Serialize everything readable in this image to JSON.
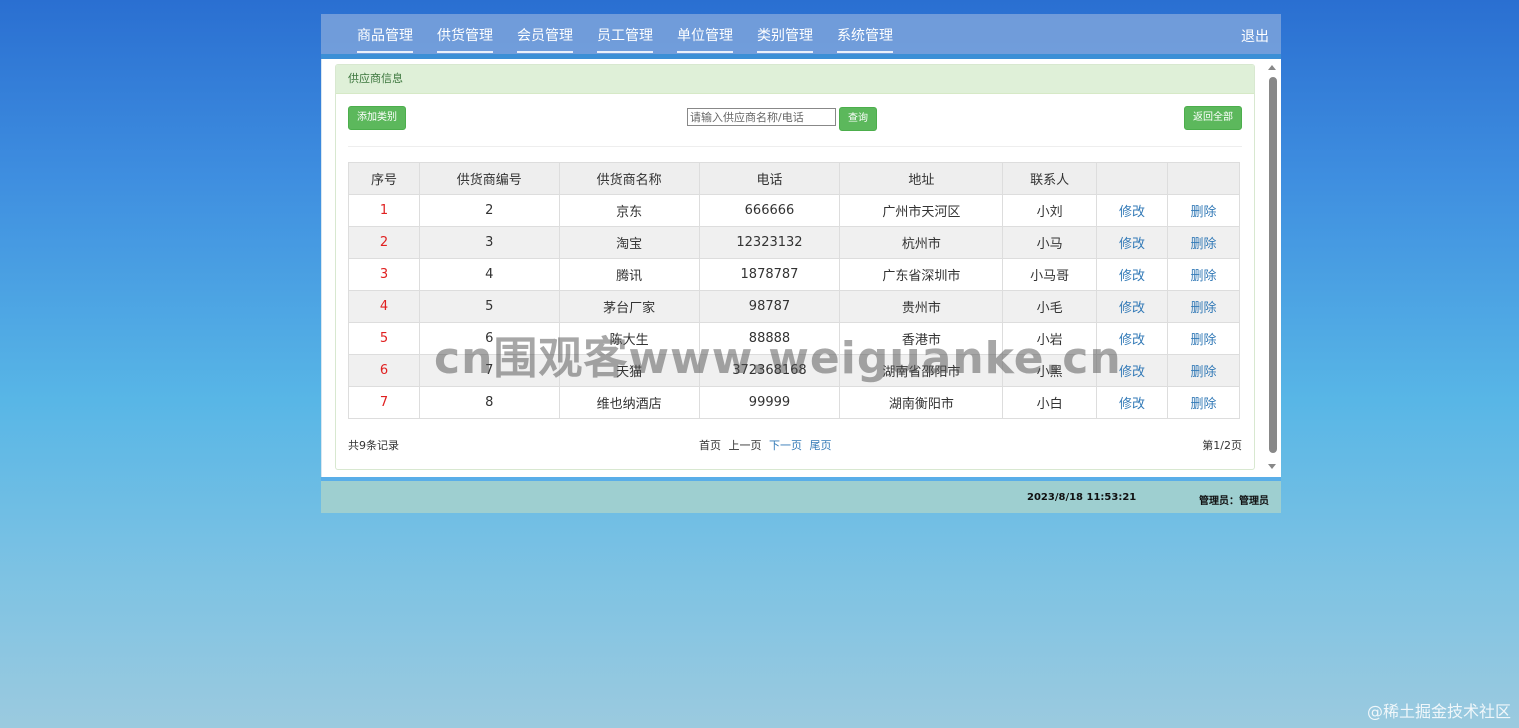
{
  "nav": {
    "items": [
      {
        "label": "商品管理"
      },
      {
        "label": "供货管理"
      },
      {
        "label": "会员管理"
      },
      {
        "label": "员工管理"
      },
      {
        "label": "单位管理"
      },
      {
        "label": "类别管理"
      },
      {
        "label": "系统管理"
      }
    ],
    "logout": "退出"
  },
  "panel": {
    "heading": "供应商信息",
    "add_button": "添加类别",
    "search_placeholder": "请输入供应商名称/电话",
    "query_button": "查询",
    "all_button": "返回全部"
  },
  "table": {
    "headers": [
      "序号",
      "供货商编号",
      "供货商名称",
      "电话",
      "地址",
      "联系人",
      "",
      ""
    ],
    "rows": [
      {
        "seq": "1",
        "id": "2",
        "name": "京东",
        "phone": "666666",
        "address": "广州市天河区",
        "contact": "小刘",
        "edit": "修改",
        "del": "删除"
      },
      {
        "seq": "2",
        "id": "3",
        "name": "淘宝",
        "phone": "12323132",
        "address": "杭州市",
        "contact": "小马",
        "edit": "修改",
        "del": "删除"
      },
      {
        "seq": "3",
        "id": "4",
        "name": "腾讯",
        "phone": "1878787",
        "address": "广东省深圳市",
        "contact": "小马哥",
        "edit": "修改",
        "del": "删除"
      },
      {
        "seq": "4",
        "id": "5",
        "name": "茅台厂家",
        "phone": "98787",
        "address": "贵州市",
        "contact": "小毛",
        "edit": "修改",
        "del": "删除"
      },
      {
        "seq": "5",
        "id": "6",
        "name": "陈大生",
        "phone": "88888",
        "address": "香港市",
        "contact": "小岩",
        "edit": "修改",
        "del": "删除"
      },
      {
        "seq": "6",
        "id": "7",
        "name": "天猫",
        "phone": "372368168",
        "address": "湖南省邵阳市",
        "contact": "小黑",
        "edit": "修改",
        "del": "删除"
      },
      {
        "seq": "7",
        "id": "8",
        "name": "维也纳酒店",
        "phone": "99999",
        "address": "湖南衡阳市",
        "contact": "小白",
        "edit": "修改",
        "del": "删除"
      }
    ]
  },
  "footer": {
    "total": "共9条记录",
    "first": "首页",
    "prev": "上一页",
    "next": "下一页",
    "last": "尾页",
    "page_info": "第1/2页"
  },
  "status": {
    "time": "2023/8/18 11:53:21",
    "admin": "管理员：管理员"
  },
  "watermark": "cn围观客www.weiguanke.cn",
  "corner_mark": "@稀土掘金技术社区"
}
